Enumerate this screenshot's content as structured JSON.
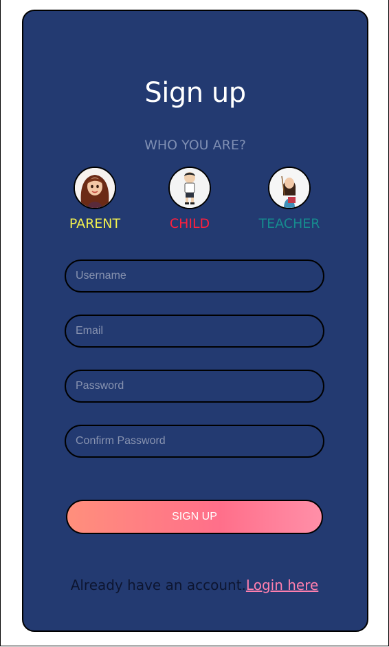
{
  "header": {
    "title": "Sign up",
    "subtitle": "WHO YOU ARE?"
  },
  "roles": [
    {
      "label": "PARENT",
      "icon": "parent-avatar-icon",
      "color": "#f2f04e"
    },
    {
      "label": "CHILD",
      "icon": "child-avatar-icon",
      "color": "#ff1f3d"
    },
    {
      "label": "TEACHER",
      "icon": "teacher-avatar-icon",
      "color": "#168b8e"
    }
  ],
  "form": {
    "username": {
      "placeholder": "Username",
      "value": ""
    },
    "email": {
      "placeholder": "Email",
      "value": ""
    },
    "password": {
      "placeholder": "Password",
      "value": ""
    },
    "confirm_password": {
      "placeholder": "Confirm Password",
      "value": ""
    },
    "submit_label": "SIGN UP"
  },
  "footer": {
    "prompt": "Already have an account.",
    "login_link": "Login here"
  },
  "colors": {
    "page_background": "#ffffff",
    "card_background": "#233a71",
    "button_gradient_start": "#ff8f7c",
    "button_gradient_end": "#ff8fa8",
    "link": "#ff7fae"
  }
}
